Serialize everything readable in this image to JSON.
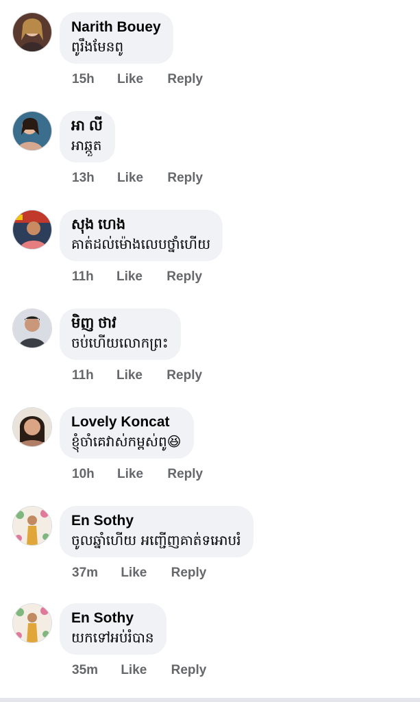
{
  "comments": [
    {
      "author": "Narith Bouey",
      "text": "ពូរឹងមែនពូ",
      "time": "15h",
      "like": "Like",
      "reply": "Reply"
    },
    {
      "author": "អា លី",
      "text": "អាឆ្កួត",
      "time": "13h",
      "like": "Like",
      "reply": "Reply"
    },
    {
      "author": "សុង ហេង",
      "text": "គាត់ដល់ម៉ោងលេបថ្នាំហើយ",
      "time": "11h",
      "like": "Like",
      "reply": "Reply"
    },
    {
      "author": "មិញ ថាវ",
      "text": "ចប់ហើយលោកព្រះ",
      "time": "11h",
      "like": "Like",
      "reply": "Reply"
    },
    {
      "author": "Lovely Koncat",
      "text": "ខ្ញុំចាំគេវាស់កម្ពស់ពូ😆",
      "time": "10h",
      "like": "Like",
      "reply": "Reply"
    },
    {
      "author": "En Sothy",
      "text": "ចូលឆ្នាំហើយ អញ្ជើញគាត់ទអោបរំ",
      "time": "37m",
      "like": "Like",
      "reply": "Reply"
    },
    {
      "author": "En Sothy",
      "text": "យកទៅអប់រំបាន",
      "time": "35m",
      "like": "Like",
      "reply": "Reply"
    }
  ]
}
